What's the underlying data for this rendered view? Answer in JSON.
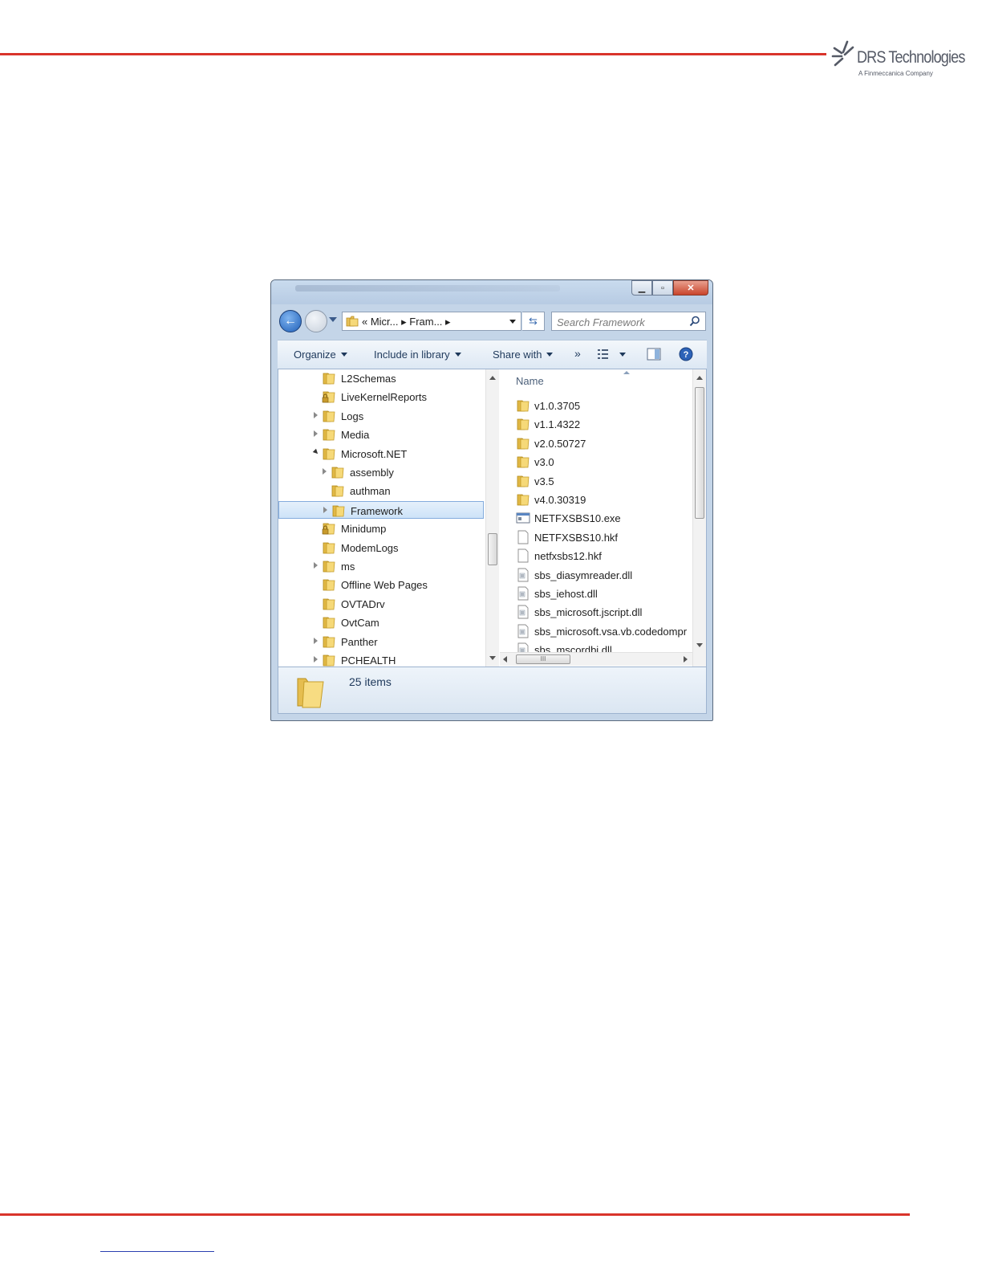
{
  "branding": {
    "logo_name": "DRS Technologies",
    "logo_subtitle": "A Finmeccanica Company",
    "accent_color": "#d9342b"
  },
  "window": {
    "caption_buttons": [
      "minimize",
      "maximize",
      "close"
    ],
    "address": {
      "crumbs": [
        "«",
        "Micr...",
        "Fram..."
      ],
      "text": "« Micr... ▸ Fram... ▸"
    },
    "search": {
      "placeholder": "Search Framework"
    },
    "toolbar": {
      "organize": "Organize",
      "include_in_library": "Include in library",
      "share_with": "Share with",
      "more": "»"
    },
    "nav_tree": [
      {
        "label": "L2Schemas",
        "expander": "none",
        "icon": "folder"
      },
      {
        "label": "LiveKernelReports",
        "expander": "none",
        "icon": "folder-locked"
      },
      {
        "label": "Logs",
        "expander": "closed",
        "icon": "folder"
      },
      {
        "label": "Media",
        "expander": "closed",
        "icon": "folder"
      },
      {
        "label": "Microsoft.NET",
        "expander": "open",
        "icon": "folder"
      },
      {
        "label": "assembly",
        "expander": "closed",
        "icon": "folder"
      },
      {
        "label": "authman",
        "expander": "none",
        "icon": "folder"
      },
      {
        "label": "Framework",
        "expander": "closed",
        "icon": "folder",
        "selected": true
      },
      {
        "label": "Minidump",
        "expander": "none",
        "icon": "folder-locked"
      },
      {
        "label": "ModemLogs",
        "expander": "none",
        "icon": "folder"
      },
      {
        "label": "ms",
        "expander": "closed",
        "icon": "folder"
      },
      {
        "label": "Offline Web Pages",
        "expander": "none",
        "icon": "folder"
      },
      {
        "label": "OVTADrv",
        "expander": "none",
        "icon": "folder"
      },
      {
        "label": "OvtCam",
        "expander": "none",
        "icon": "folder"
      },
      {
        "label": "Panther",
        "expander": "closed",
        "icon": "folder"
      },
      {
        "label": "PCHEALTH",
        "expander": "closed",
        "icon": "folder"
      }
    ],
    "file_list": {
      "column_name": "Name",
      "items": [
        {
          "label": "v1.0.3705",
          "icon": "folder"
        },
        {
          "label": "v1.1.4322",
          "icon": "folder"
        },
        {
          "label": "v2.0.50727",
          "icon": "folder"
        },
        {
          "label": "v3.0",
          "icon": "folder"
        },
        {
          "label": "v3.5",
          "icon": "folder"
        },
        {
          "label": "v4.0.30319",
          "icon": "folder"
        },
        {
          "label": "NETFXSBS10.exe",
          "icon": "exe"
        },
        {
          "label": "NETFXSBS10.hkf",
          "icon": "file"
        },
        {
          "label": "netfxsbs12.hkf",
          "icon": "file"
        },
        {
          "label": "sbs_diasymreader.dll",
          "icon": "dll"
        },
        {
          "label": "sbs_iehost.dll",
          "icon": "dll"
        },
        {
          "label": "sbs_microsoft.jscript.dll",
          "icon": "dll"
        },
        {
          "label": "sbs_microsoft.vsa.vb.codedompr",
          "icon": "dll"
        },
        {
          "label": "sbs_mscordbi.dll",
          "icon": "dll"
        }
      ]
    },
    "hscroll_thumb": "III",
    "status": {
      "item_count": "25 items"
    }
  }
}
